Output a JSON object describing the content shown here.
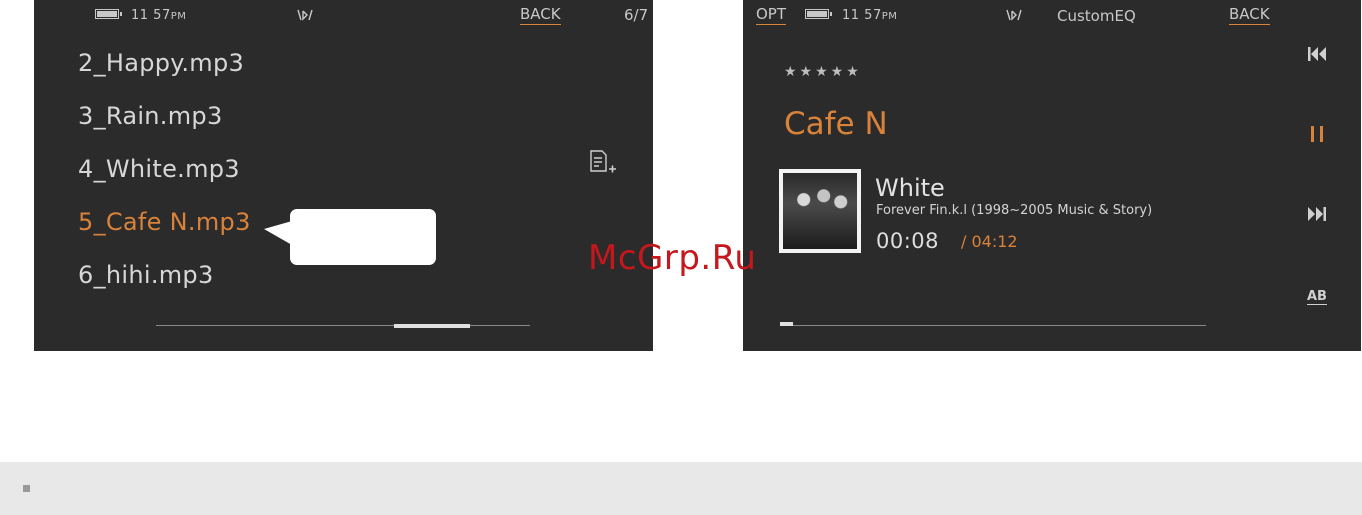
{
  "left_screen": {
    "status": {
      "time": "11 57",
      "ampm": "PM",
      "back_label": "BACK",
      "page_indicator": "6/7"
    },
    "tracks": [
      {
        "label": "2_Happy.mp3",
        "active": false
      },
      {
        "label": "3_Rain.mp3",
        "active": false
      },
      {
        "label": "4_White.mp3",
        "active": false
      },
      {
        "label": "5_Cafe N.mp3",
        "active": true
      },
      {
        "label": "6_hihi.mp3",
        "active": false
      }
    ],
    "scroll_position": 0.8
  },
  "right_screen": {
    "status": {
      "opt_label": "OPT",
      "time": "11 57",
      "ampm": "PM",
      "eq_label": "CustomEQ",
      "back_label": "BACK"
    },
    "rating_stars": "★★★★★",
    "artist": "Cafe N",
    "song_title": "White",
    "album": "Forever Fin.k.l (1998~2005 Music & Story)",
    "elapsed": "00:08",
    "total": "/ 04:12",
    "ab_label": "AB",
    "progress_fraction": 0.03
  },
  "watermark": "McGrp.Ru",
  "colors": {
    "accent": "#d9823a",
    "screen_bg": "#2b2b2b",
    "watermark": "#c6171c"
  }
}
